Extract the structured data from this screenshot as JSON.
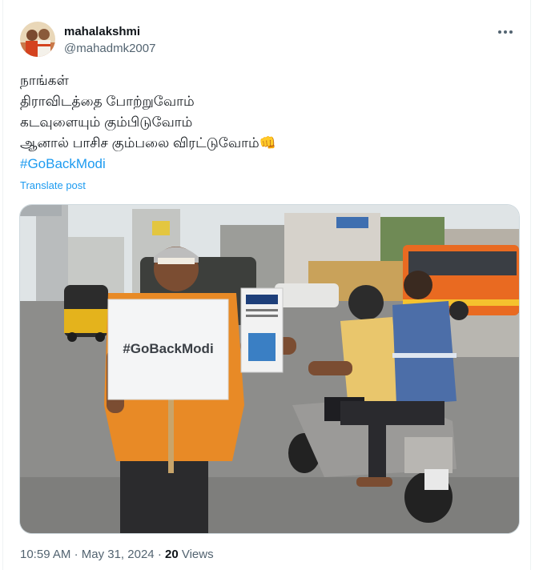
{
  "tweet": {
    "author": {
      "name": "mahalakshmi",
      "handle": "@mahadmk2007",
      "avatar_icon": "avatar-photo"
    },
    "lines": [
      "நாங்கள்",
      "திராவிடத்தை போற்றுவோம்",
      "கடவுளையும் கும்பிடுவோம்",
      "ஆனால் பாசிச கும்பலை விரட்டுவோம்"
    ],
    "emoji": "👊",
    "hashtag": "#GoBackModi",
    "translate_label": "Translate post",
    "media": {
      "sign_text": "#GoBackModi",
      "book_text": "தமிழகத்தை வஞ்சிக்கும் பிரதமர்"
    },
    "time": "10:59 AM",
    "separator": "·",
    "date": "May 31, 2024",
    "views_count": "20",
    "views_label": "Views"
  },
  "colors": {
    "link": "#1d9bf0",
    "secondary_text": "#536471",
    "primary_text": "#0f1419"
  }
}
